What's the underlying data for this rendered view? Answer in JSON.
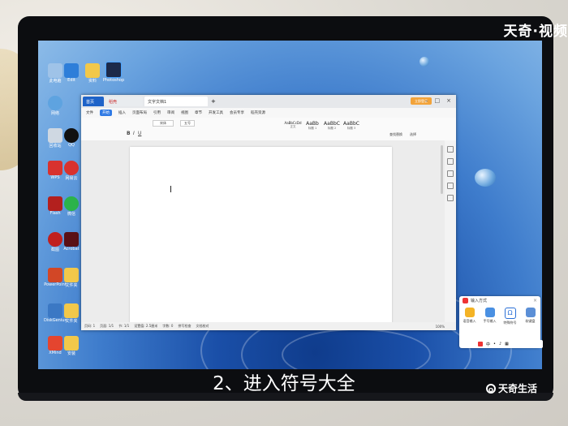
{
  "overlay": {
    "top_watermark": "天奇·视频",
    "subtitle": "2、进入符号大全",
    "bottom_watermark": "天奇生活"
  },
  "wps": {
    "tabs": [
      {
        "label": "首页"
      },
      {
        "label": "稻壳"
      },
      {
        "label": "文字文档1"
      }
    ],
    "new_tab": "+",
    "login_label": "立即登录",
    "menus": [
      "文件",
      "开始",
      "插入",
      "页面布局",
      "引用",
      "审阅",
      "视图",
      "章节",
      "开发工具",
      "会员专享",
      "稻壳资源"
    ],
    "active_menu": "开始",
    "font_name": "宋体",
    "font_size": "五号",
    "styles": [
      {
        "sample": "AaBbCcDd",
        "name": "正文"
      },
      {
        "sample": "AaBb",
        "name": "标题 1"
      },
      {
        "sample": "AaBbC",
        "name": "标题 2"
      },
      {
        "sample": "AaBbC",
        "name": "标题 3"
      }
    ],
    "search_label": "查找替换",
    "select_label": "选择",
    "status": {
      "page": "页码: 1",
      "pages": "页面: 1/1",
      "section": "节: 1/1",
      "position": "设置值: 2.5厘米",
      "words": "字数: 0",
      "spell": "拼写检查",
      "proofread": "文档校对",
      "zoom": "100%"
    }
  },
  "ime": {
    "title": "输入方式",
    "buttons": [
      {
        "label": "语音输入"
      },
      {
        "label": "手写输入"
      },
      {
        "label": "特殊符号"
      },
      {
        "label": "软键盘"
      }
    ]
  },
  "desktop_icons": [
    {
      "label": "此电脑"
    },
    {
      "label": "Edit"
    },
    {
      "label": "资料"
    },
    {
      "label": "Photoshop"
    },
    {
      "label": "网络"
    },
    {
      "label": "回收站"
    },
    {
      "label": "QQ"
    },
    {
      "label": "WPS"
    },
    {
      "label": "网易云"
    },
    {
      "label": "Flash"
    },
    {
      "label": "微信"
    },
    {
      "label": "截图"
    },
    {
      "label": "Acrobat"
    },
    {
      "label": "PowerPoint"
    },
    {
      "label": "文件夹"
    },
    {
      "label": "DiskGenius"
    },
    {
      "label": "文件夹"
    },
    {
      "label": "XMind"
    },
    {
      "label": "安装"
    }
  ],
  "colors": {
    "wps_blue": "#1e63c8",
    "login_orange": "#f2a33a",
    "ime_red": "#e33333"
  }
}
